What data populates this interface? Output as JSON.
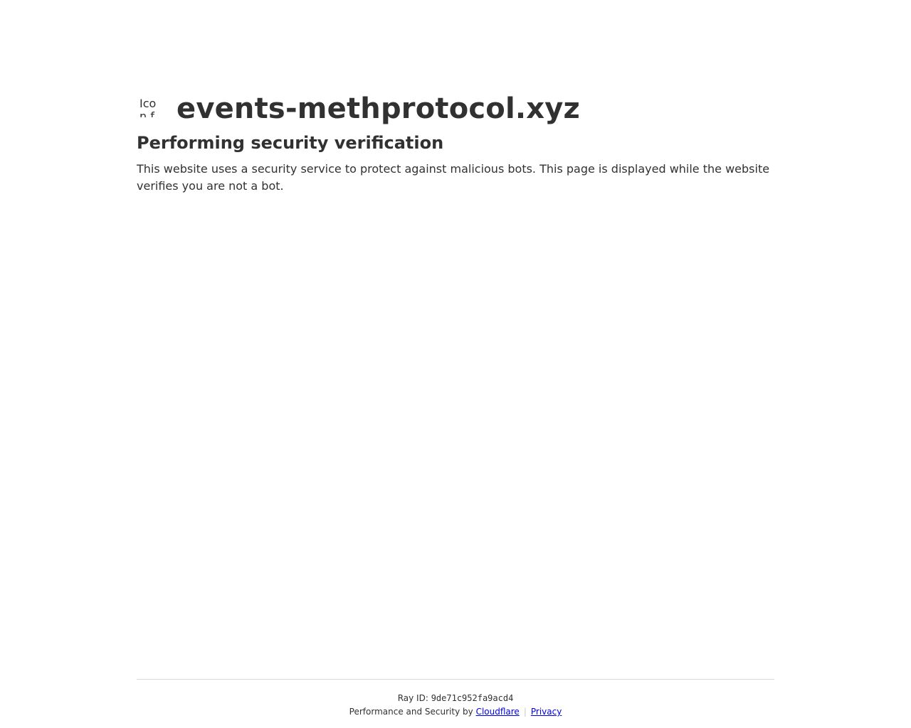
{
  "header": {
    "favicon_alt": "Icon for events-methprotocol.xyz",
    "domain": "events-methprotocol.xyz"
  },
  "main": {
    "heading": "Performing security verification",
    "description": "This website uses a security service to protect against malicious bots. This page is displayed while the website verifies you are not a bot."
  },
  "footer": {
    "ray_label": "Ray ID:",
    "ray_id": "9de71c952fa9acd4",
    "performance_text": "Performance and Security by",
    "cloudflare_link": "Cloudflare",
    "separator": "|",
    "privacy_link": "Privacy"
  }
}
